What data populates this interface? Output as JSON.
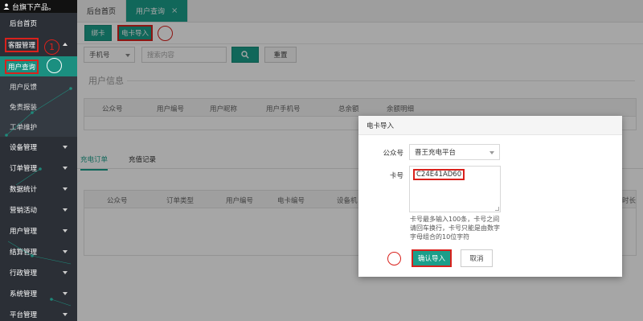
{
  "sidebar": {
    "brand": "台旗下产品。",
    "items": [
      {
        "label": "后台首页"
      },
      {
        "label": "客服管理"
      },
      {
        "label": "设备管理"
      },
      {
        "label": "订单管理"
      },
      {
        "label": "数据统计"
      },
      {
        "label": "营销活动"
      },
      {
        "label": "用户管理"
      },
      {
        "label": "结算管理"
      },
      {
        "label": "行政管理"
      },
      {
        "label": "系统管理"
      },
      {
        "label": "平台管理"
      }
    ],
    "sub_items": [
      {
        "label": "用户查询"
      },
      {
        "label": "用户反馈"
      },
      {
        "label": "免责报装"
      },
      {
        "label": "工单维护"
      }
    ],
    "annotation_num": "1"
  },
  "tabs": [
    {
      "label": "后台首页"
    },
    {
      "label": "用户查询",
      "close": "×"
    }
  ],
  "actions": {
    "bind_card": "绑卡",
    "card_import": "电卡导入"
  },
  "filters": {
    "select_value": "手机号",
    "search_placeholder": "搜索内容",
    "reset": "重置"
  },
  "user_info": {
    "title": "用户信息",
    "columns": [
      "公众号",
      "用户编号",
      "用户昵称",
      "用户手机号",
      "总余额",
      "余额明细"
    ]
  },
  "subtabs": [
    "充电订单",
    "充值记录"
  ],
  "orders": {
    "columns": [
      "公众号",
      "订单类型",
      "用户编号",
      "电卡编号",
      "设备机",
      "工作时长("
    ]
  },
  "modal": {
    "title": "电卡导入",
    "account_label": "公众号",
    "account_value": "晋王充电平台",
    "card_label": "卡号",
    "card_value": "C24E41AD60",
    "hint": "卡号最多输入100条，卡号之间请回车换行，卡号只能是由数字字母组合的10位字符",
    "confirm": "确认导入",
    "cancel": "取消"
  },
  "colors": {
    "teal": "#1b9e8a",
    "sidebar": "#2b2f36",
    "annotation_red": "#d9211c"
  }
}
